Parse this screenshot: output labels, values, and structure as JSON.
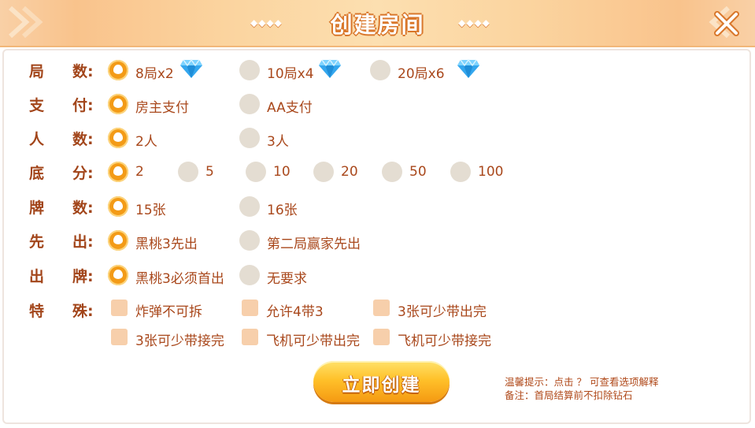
{
  "header": {
    "title": "创建房间",
    "left_deco": "◆◆◆◆",
    "right_deco": "◆◆◆◆"
  },
  "rows": [
    {
      "label": [
        "局",
        "数:"
      ],
      "options": [
        {
          "text": "8局x2",
          "selected": true,
          "gem": true
        },
        {
          "text": "10局x4",
          "selected": false,
          "gem": true
        },
        {
          "text": "20局x6",
          "selected": false,
          "gem": true
        }
      ]
    },
    {
      "label": [
        "支",
        "付:"
      ],
      "options": [
        {
          "text": "房主支付",
          "selected": true
        },
        {
          "text": "AA支付",
          "selected": false
        }
      ]
    },
    {
      "label": [
        "人",
        "数:"
      ],
      "options": [
        {
          "text": "2人",
          "selected": true
        },
        {
          "text": "3人",
          "selected": false
        }
      ]
    },
    {
      "label": [
        "底",
        "分:"
      ],
      "options": [
        {
          "text": "2",
          "selected": true
        },
        {
          "text": "5",
          "selected": false
        },
        {
          "text": "10",
          "selected": false
        },
        {
          "text": "20",
          "selected": false
        },
        {
          "text": "50",
          "selected": false
        },
        {
          "text": "100",
          "selected": false
        }
      ]
    },
    {
      "label": [
        "牌",
        "数:"
      ],
      "options": [
        {
          "text": "15张",
          "selected": true
        },
        {
          "text": "16张",
          "selected": false
        }
      ]
    },
    {
      "label": [
        "先",
        "出:"
      ],
      "options": [
        {
          "text": "黑桃3先出",
          "selected": true
        },
        {
          "text": "第二局赢家先出",
          "selected": false
        }
      ]
    },
    {
      "label": [
        "出",
        "牌:"
      ],
      "options": [
        {
          "text": "黑桃3必须首出",
          "selected": true
        },
        {
          "text": "无要求",
          "selected": false
        }
      ]
    }
  ],
  "special": {
    "label": [
      "特",
      "殊:"
    ],
    "options": [
      {
        "text": "炸弹不可拆",
        "checked": false
      },
      {
        "text": "允许4带3",
        "checked": false
      },
      {
        "text": "3张可少带出完",
        "checked": false
      },
      {
        "text": "3张可少带接完",
        "checked": false
      },
      {
        "text": "飞机可少带出完",
        "checked": false
      },
      {
        "text": "飞机可少带接完",
        "checked": false
      }
    ]
  },
  "create_button": "立即创建",
  "tips": {
    "line1": "温馨提示：点击 ？ 可查看选项解释",
    "line2": "备注：首局结算前不扣除钻石"
  },
  "colors": {
    "accent": "#f39b17",
    "label": "#a2451a",
    "header": "#f9c38c",
    "check": "#f7cfab"
  }
}
